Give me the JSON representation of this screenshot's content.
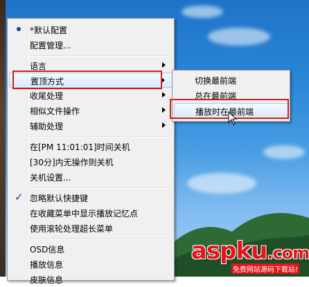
{
  "main_menu": {
    "items": [
      {
        "label": "*默认配置"
      },
      {
        "label": "配置管理..."
      },
      {
        "label": "语言"
      },
      {
        "label": "置顶方式"
      },
      {
        "label": "收尾处理"
      },
      {
        "label": "相似文件操作"
      },
      {
        "label": "辅助处理"
      },
      {
        "label": "在[PM 11:01:01]时间关机"
      },
      {
        "label": "[30分]内无操作则关机"
      },
      {
        "label": "关机设置..."
      },
      {
        "label": "忽略默认快捷键"
      },
      {
        "label": "在收藏菜单中显示播放记忆点"
      },
      {
        "label": "使用滚轮处理超长菜单"
      },
      {
        "label": "OSD信息"
      },
      {
        "label": "播放信息"
      },
      {
        "label": "皮肤信息"
      }
    ]
  },
  "sub_menu": {
    "items": [
      {
        "label": "切换最前端"
      },
      {
        "label": "总在最前端"
      },
      {
        "label": "播放时在最前端"
      }
    ]
  },
  "watermark": {
    "logo": "aspku",
    "tld": ".com",
    "tagline": "免费网站源码下载站!"
  }
}
